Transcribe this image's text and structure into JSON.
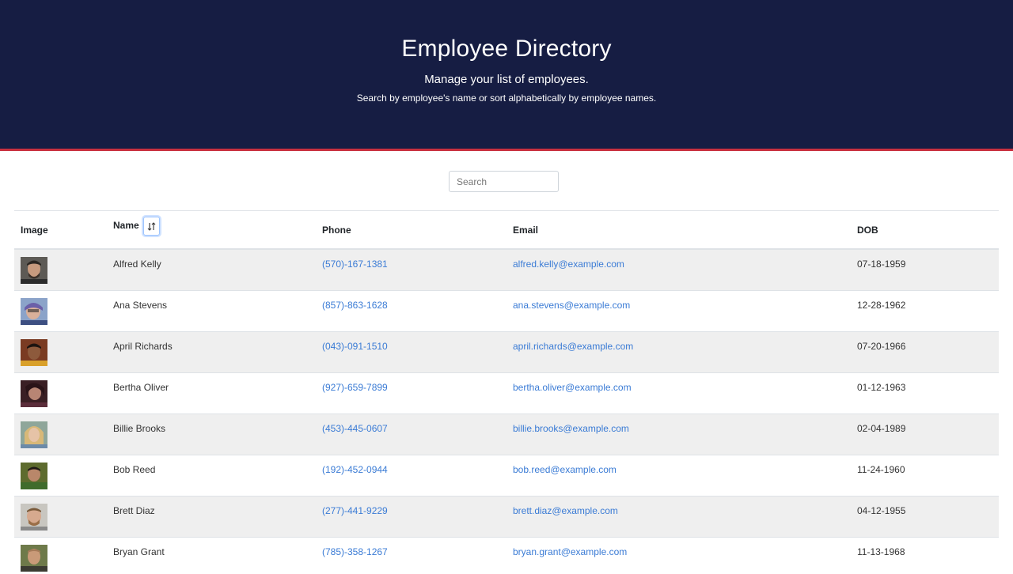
{
  "header": {
    "title": "Employee Directory",
    "subtitle": "Manage your list of employees.",
    "description": "Search by employee's name or sort alphabetically by employee names.",
    "bg_color": "#161d43",
    "accent_color": "#c9303f"
  },
  "search": {
    "placeholder": "Search",
    "value": ""
  },
  "table": {
    "columns": [
      "Image",
      "Name",
      "Phone",
      "Email",
      "DOB"
    ],
    "sort_icon": "sort-arrows-icon",
    "rows": [
      {
        "name": "Alfred Kelly",
        "phone": "(570)-167-1381",
        "email": "alfred.kelly@example.com",
        "dob": "07-18-1959"
      },
      {
        "name": "Ana Stevens",
        "phone": "(857)-863-1628",
        "email": "ana.stevens@example.com",
        "dob": "12-28-1962"
      },
      {
        "name": "April Richards",
        "phone": "(043)-091-1510",
        "email": "april.richards@example.com",
        "dob": "07-20-1966"
      },
      {
        "name": "Bertha Oliver",
        "phone": "(927)-659-7899",
        "email": "bertha.oliver@example.com",
        "dob": "01-12-1963"
      },
      {
        "name": "Billie Brooks",
        "phone": "(453)-445-0607",
        "email": "billie.brooks@example.com",
        "dob": "02-04-1989"
      },
      {
        "name": "Bob Reed",
        "phone": "(192)-452-0944",
        "email": "bob.reed@example.com",
        "dob": "11-24-1960"
      },
      {
        "name": "Brett Diaz",
        "phone": "(277)-441-9229",
        "email": "brett.diaz@example.com",
        "dob": "04-12-1955"
      },
      {
        "name": "Bryan Grant",
        "phone": "(785)-358-1267",
        "email": "bryan.grant@example.com",
        "dob": "11-13-1968"
      }
    ]
  }
}
